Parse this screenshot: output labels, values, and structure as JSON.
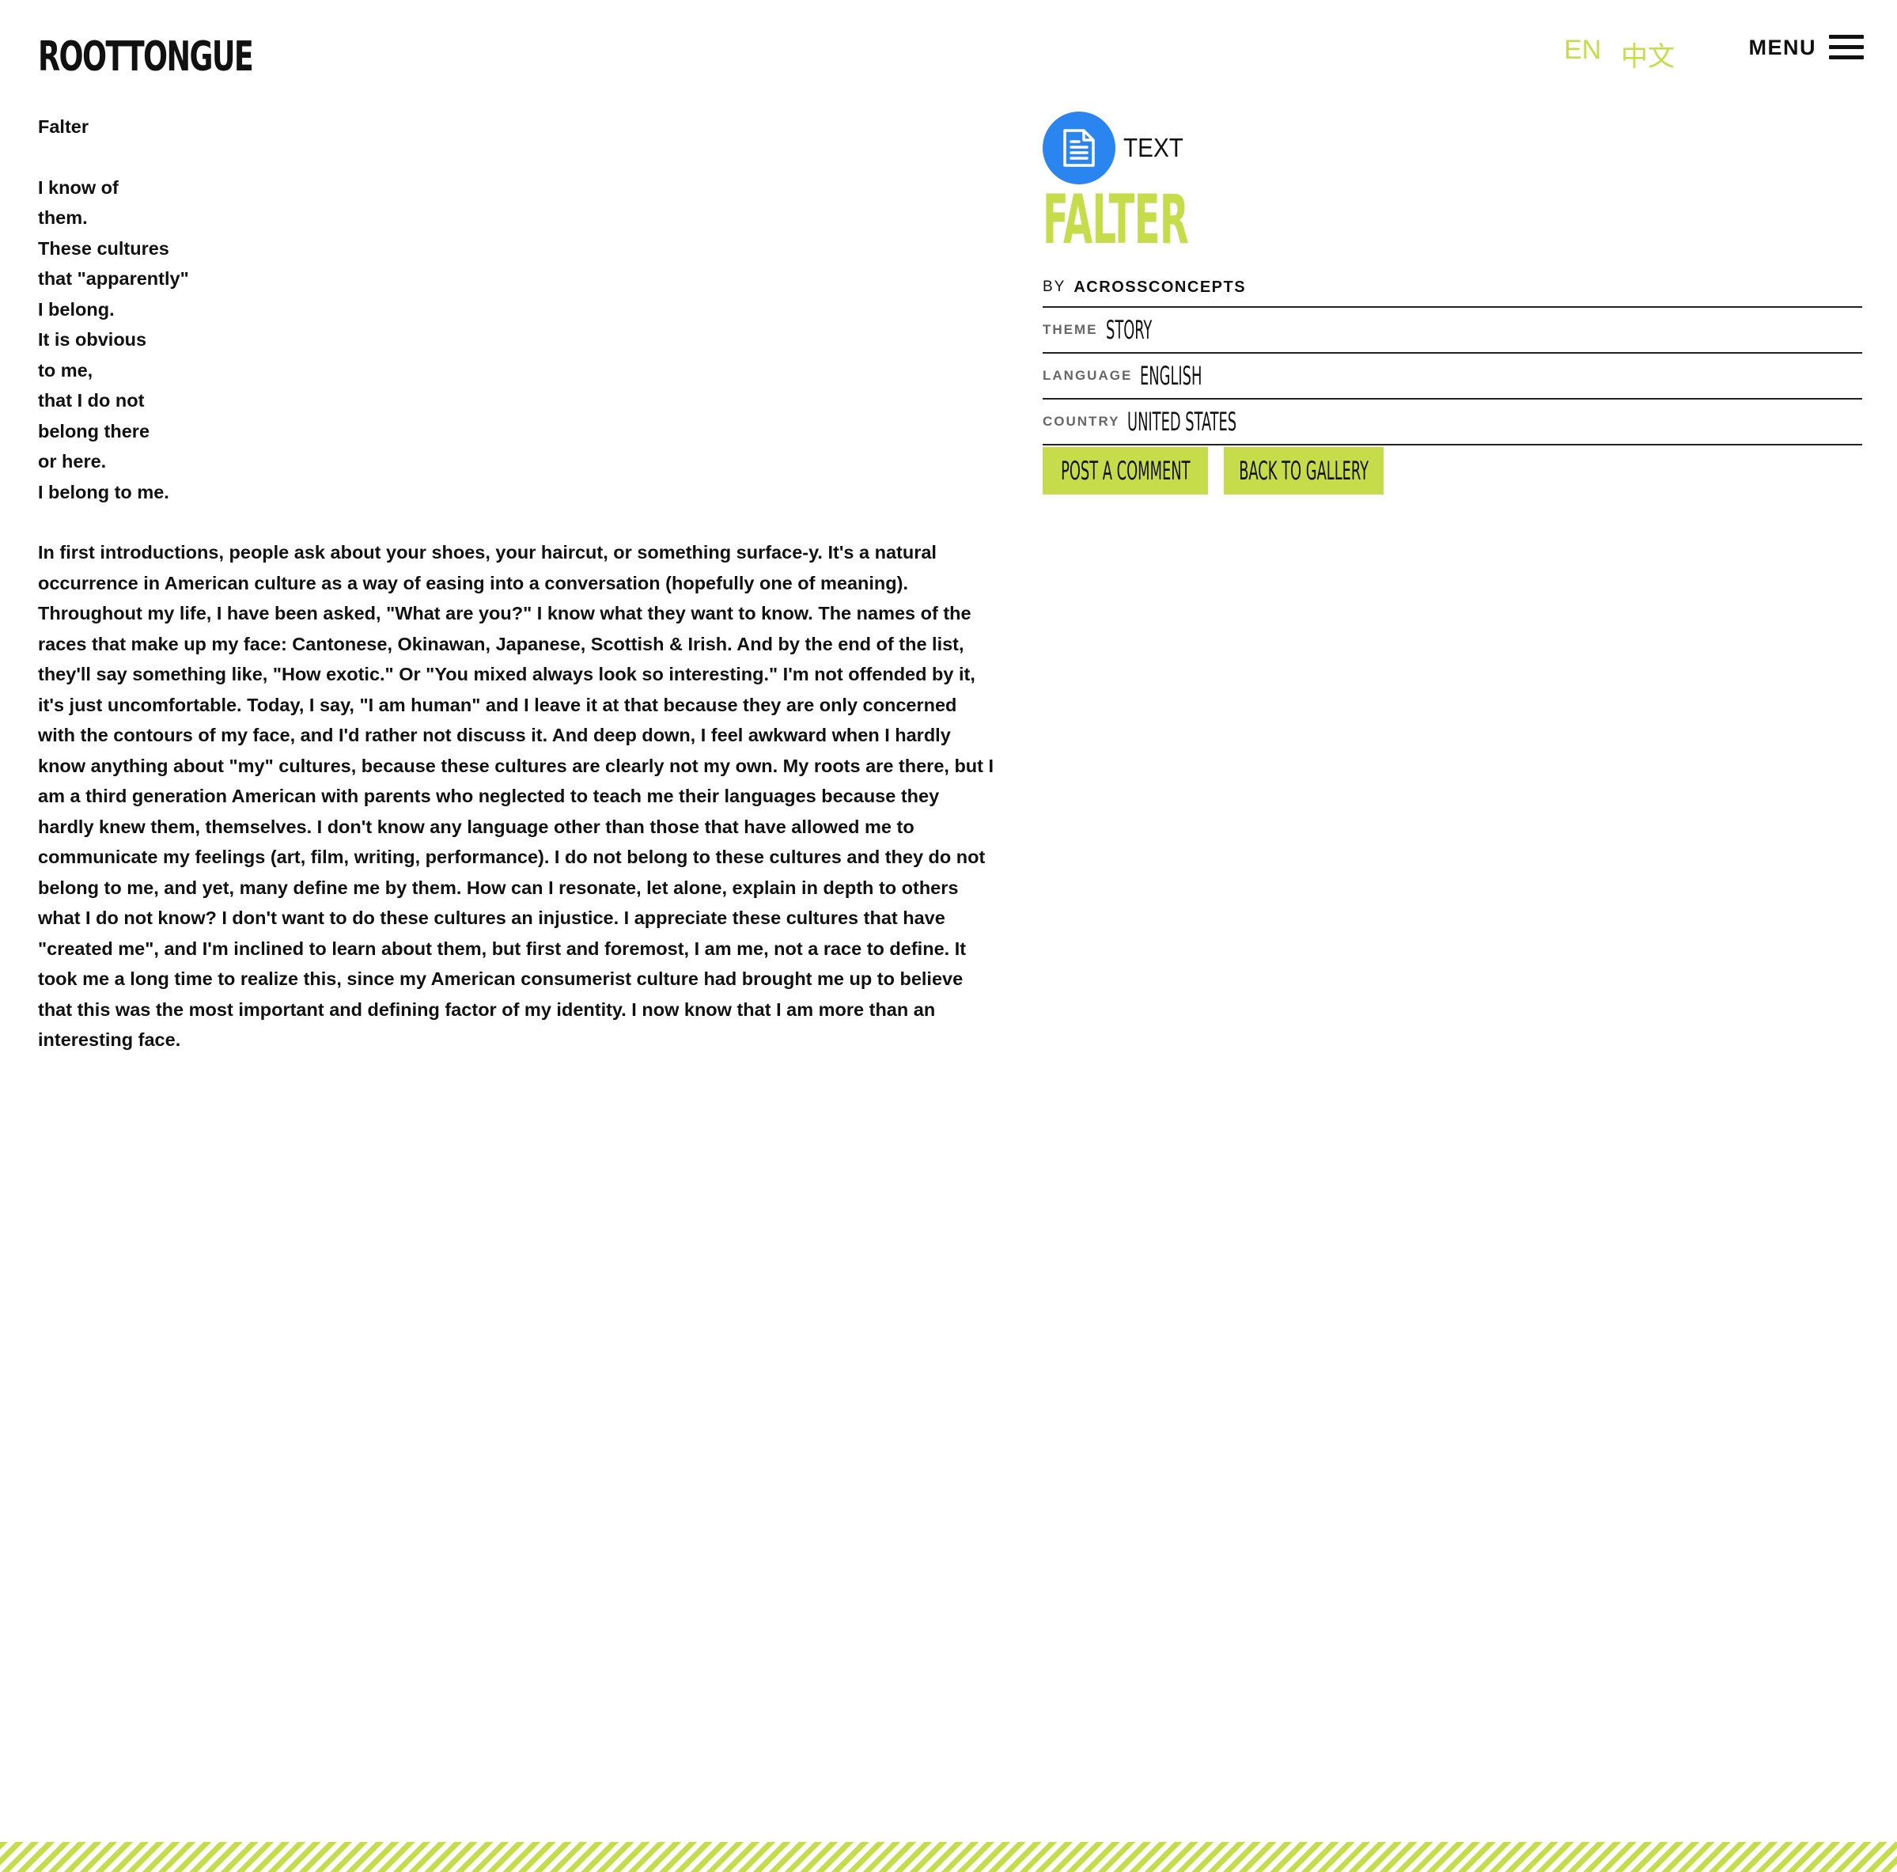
{
  "header": {
    "logo_text": "ROOTTONGUE",
    "lang_en": "EN",
    "lang_zh": "中文",
    "menu_label": "MENU",
    "menu_icon": "hamburger-icon"
  },
  "colors": {
    "accent": "#c6dc4a",
    "icon_bg": "#2b85f0",
    "text": "#111111"
  },
  "story": {
    "title": "Falter",
    "poem": [
      "I know of",
      "them.",
      "These cultures",
      "that \"apparently\"",
      "I belong.",
      "It is obvious",
      "to me,",
      "that I do not",
      "belong there",
      "or here.",
      "I belong to me."
    ],
    "paragraph1": "In first introductions, people ask about your shoes, your haircut, or something surface-y. It's a natural occurrence in American culture as a way of easing into a conversation (hopefully one of meaning).",
    "paragraph2": "Throughout my life, I have been asked, \"What are you?\" I know what they want to know. The names of the races that make up my face: Cantonese, Okinawan, Japanese, Scottish & Irish. And by the end of the list, they'll say something like, \"How exotic.\" Or \"You mixed always look so interesting.\" I'm not offended by it, it's just uncomfortable. Today, I say, \"I am human\" and I leave it at that because they are only concerned with the contours of my face, and I'd rather not discuss it. And deep down, I feel awkward when I hardly know anything about \"my\" cultures, because these cultures are clearly not my own. My roots are there, but I am a third generation American with parents who neglected to teach me their languages because they hardly knew them, themselves. I don't know any language other than those that have allowed me to communicate my feelings (art, film, writing, performance). I do not belong to these cultures and they do not belong to me, and yet, many define me by them. How can I resonate, let alone, explain in depth to others what I do not know? I don't want to do these cultures an injustice. I appreciate these cultures that have \"created me\", and I'm inclined to learn about them, but first and foremost, I am me, not a race to define. It took me a long time to realize this, since my American consumerist culture had brought me up to believe that this was the most important and defining factor of my identity. I now know that I am more than an interesting face."
  },
  "sidebar": {
    "type_icon": "document-icon",
    "type_label": "TEXT",
    "title": "FALTER",
    "by_label": "BY",
    "author": "ACROSSCONCEPTS",
    "meta": [
      {
        "label": "THEME",
        "value": "STORY"
      },
      {
        "label": "LANGUAGE",
        "value": "ENGLISH"
      },
      {
        "label": "COUNTRY",
        "value": "UNITED STATES"
      }
    ],
    "post_comment": "POST A COMMENT",
    "back_gallery": "BACK TO GALLERY"
  }
}
